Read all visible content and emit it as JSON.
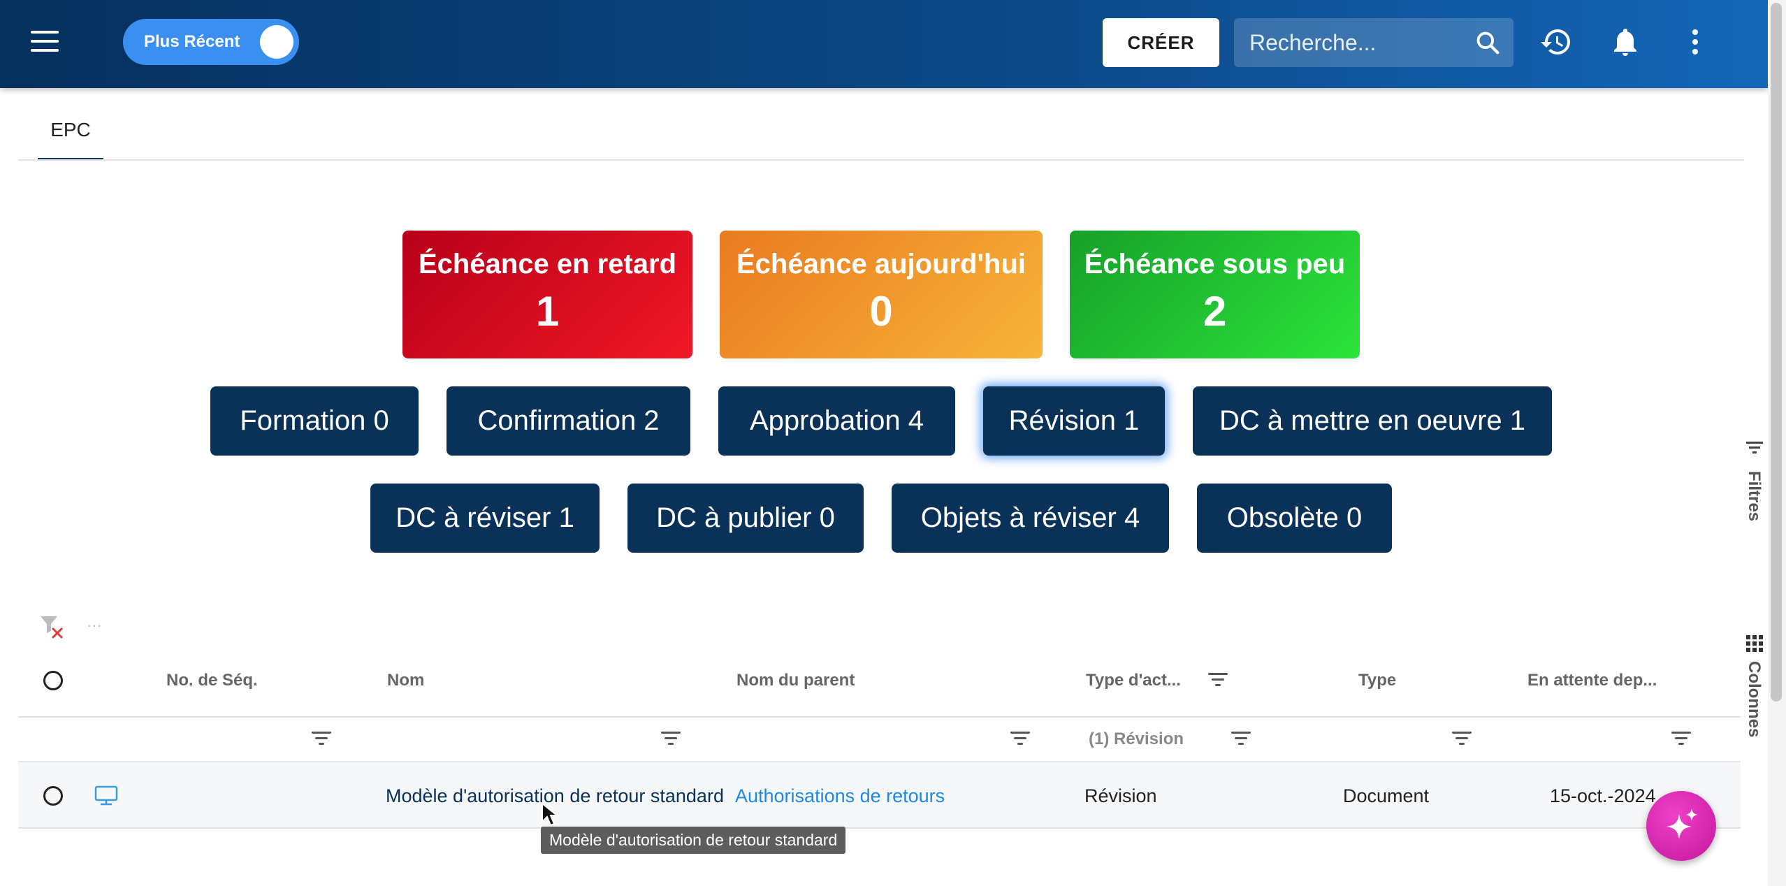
{
  "header": {
    "toggle_label": "Plus Récent",
    "create_label": "CRÉER",
    "search_placeholder": "Recherche..."
  },
  "tabs": [
    {
      "label": "EPC",
      "active": true
    }
  ],
  "due_cards": [
    {
      "title": "Échéance en retard",
      "count": "1",
      "color": "#d30b1f"
    },
    {
      "title": "Échéance aujourd'hui",
      "count": "0",
      "color": "#f29a2e"
    },
    {
      "title": "Échéance sous peu",
      "count": "2",
      "color": "#22c933"
    }
  ],
  "categories": [
    {
      "label": "Formation 0"
    },
    {
      "label": "Confirmation 2"
    },
    {
      "label": "Approbation 4"
    },
    {
      "label": "Révision 1",
      "active": true
    },
    {
      "label": "DC à mettre en oeuvre 1"
    },
    {
      "label": "DC à réviser 1"
    },
    {
      "label": "DC à publier 0"
    },
    {
      "label": "Objets à réviser 4"
    },
    {
      "label": "Obsolète 0"
    }
  ],
  "side_rail": {
    "filters_label": "Filtres",
    "columns_label": "Colonnes"
  },
  "grid": {
    "toolbar_more": "···",
    "columns": [
      "No. de Séq.",
      "Nom",
      "Nom du parent",
      "Type d'act...",
      "Type",
      "En attente dep..."
    ],
    "type_filter_value": "(1) Révision",
    "rows": [
      {
        "seq": "",
        "name": "Modèle d'autorisation de retour standard",
        "parent": "Authorisations de retours",
        "action_type": "Révision",
        "type": "Document",
        "waiting_since": "15-oct.-2024"
      }
    ],
    "tooltip": "Modèle d'autorisation de retour standard"
  },
  "colors": {
    "primary_dark": "#0a3158",
    "accent_blue": "#3a8ff0",
    "link": "#1e88e5",
    "fab": "#d41fb0"
  }
}
